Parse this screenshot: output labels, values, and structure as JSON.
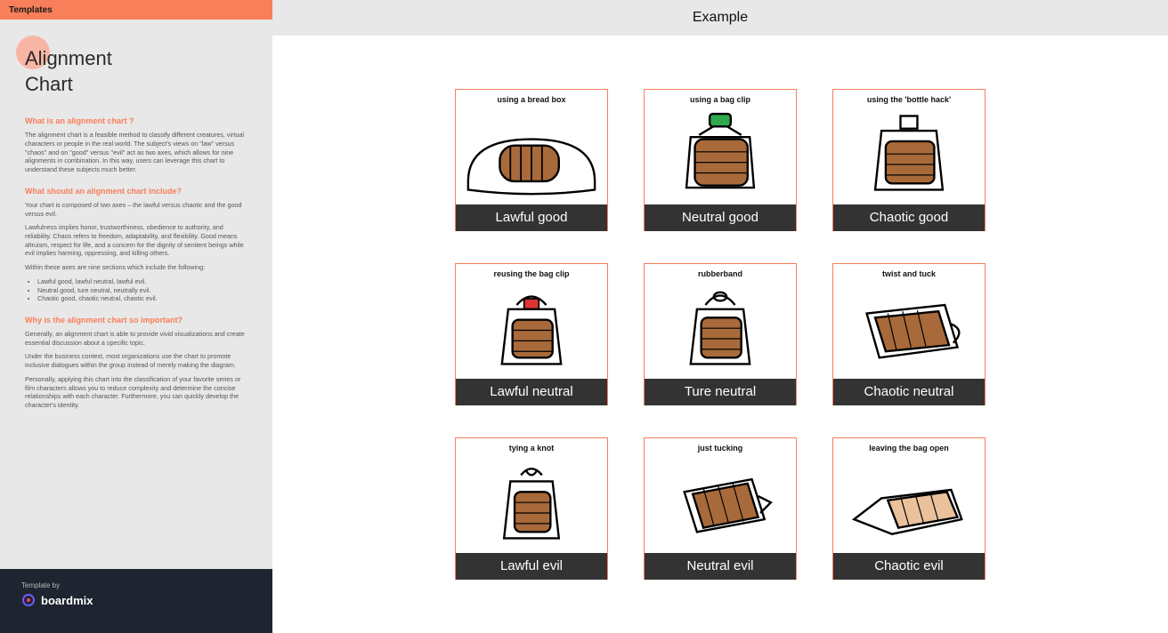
{
  "sidebar": {
    "header": "Templates",
    "title_line1": "Alignment",
    "title_line2": "Chart",
    "sections": [
      {
        "heading": "What is an alignment chart ?",
        "paragraphs": [
          "The alignment chart is a feasible method to classify different creatures, virtual characters or people in the real world. The subject's views on \"law\" versus \"chaos\" and on \"good\" versus \"evil\" act as two axes, which allows for nine alignments in combination. In this way, users can leverage this chart to understand these subjects much better."
        ]
      },
      {
        "heading": "What should an alignment chart include?",
        "paragraphs": [
          "Your chart is composed of two axes – the lawful versus chaotic and the good versus evil.",
          "Lawfulness implies honor, trustworthiness, obedience to authority, and reliability. Chaos refers to freedom, adaptability, and flexibility. Good means altruism, respect for life, and a concern for the dignity of sentient beings while evil implies harming, oppressing, and killing others.",
          "Within these axes are nine sections which include the following:"
        ],
        "bullets": [
          "Lawful good, lawful neutral, lawful evil.",
          "Neutral good, ture neutral, neutrally evil.",
          "Chaotic good, chaotic neutral, chaotic evil."
        ]
      },
      {
        "heading": "Why is the alignment chart so important?",
        "paragraphs": [
          "Generally, an alignment chart is able to provide vivid visualizations and create essential discussion about a specific topic.",
          "Under the business context, most organizations use the chart to promote inclusive dialogues within the group instead of merely making the diagram.",
          "Personally, applying this chart into the classification of your favorite series or film characters allows you to reduce complexity and determine the concise relationships with each character. Furthermore, you can quickly develop the character's identity."
        ]
      }
    ],
    "footer_label": "Template by",
    "brand": "boardmix"
  },
  "main": {
    "header": "Example",
    "cells": [
      {
        "caption": "using a bread box",
        "label": "Lawful good"
      },
      {
        "caption": "using a bag clip",
        "label": "Neutral good"
      },
      {
        "caption": "using the 'bottle hack'",
        "label": "Chaotic good"
      },
      {
        "caption": "reusing the bag clip",
        "label": "Lawful neutral"
      },
      {
        "caption": "rubberband",
        "label": "Ture neutral"
      },
      {
        "caption": "twist and tuck",
        "label": "Chaotic neutral"
      },
      {
        "caption": "tying a knot",
        "label": "Lawful evil"
      },
      {
        "caption": "just tucking",
        "label": "Neutral evil"
      },
      {
        "caption": "leaving the bag open",
        "label": "Chaotic evil"
      }
    ]
  }
}
